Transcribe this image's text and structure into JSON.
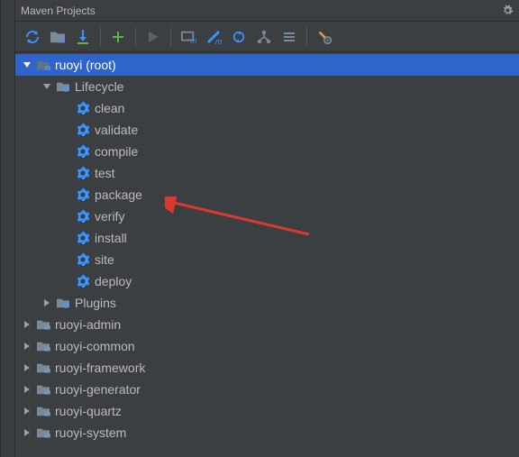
{
  "panel": {
    "title": "Maven Projects"
  },
  "toolbar": {
    "refresh": "Refresh",
    "generate": "Generate",
    "download": "Download",
    "add": "Add",
    "run": "Run",
    "exec": "Execute",
    "skip": "Toggle Skip",
    "sync": "Sync",
    "dep": "Dependencies",
    "collapse": "Collapse",
    "settings": "Settings"
  },
  "tree": {
    "root": "ruoyi (root)",
    "lifecycle": "Lifecycle",
    "goals": [
      "clean",
      "validate",
      "compile",
      "test",
      "package",
      "verify",
      "install",
      "site",
      "deploy"
    ],
    "plugins": "Plugins",
    "modules": [
      "ruoyi-admin",
      "ruoyi-common",
      "ruoyi-framework",
      "ruoyi-generator",
      "ruoyi-quartz",
      "ruoyi-system"
    ]
  },
  "colors": {
    "accent": "#2f65ca",
    "gear": "#40a0ff",
    "folder": "#7a8a99",
    "green": "#62b543",
    "play": "#62b543",
    "arrow": "#d73a30"
  }
}
